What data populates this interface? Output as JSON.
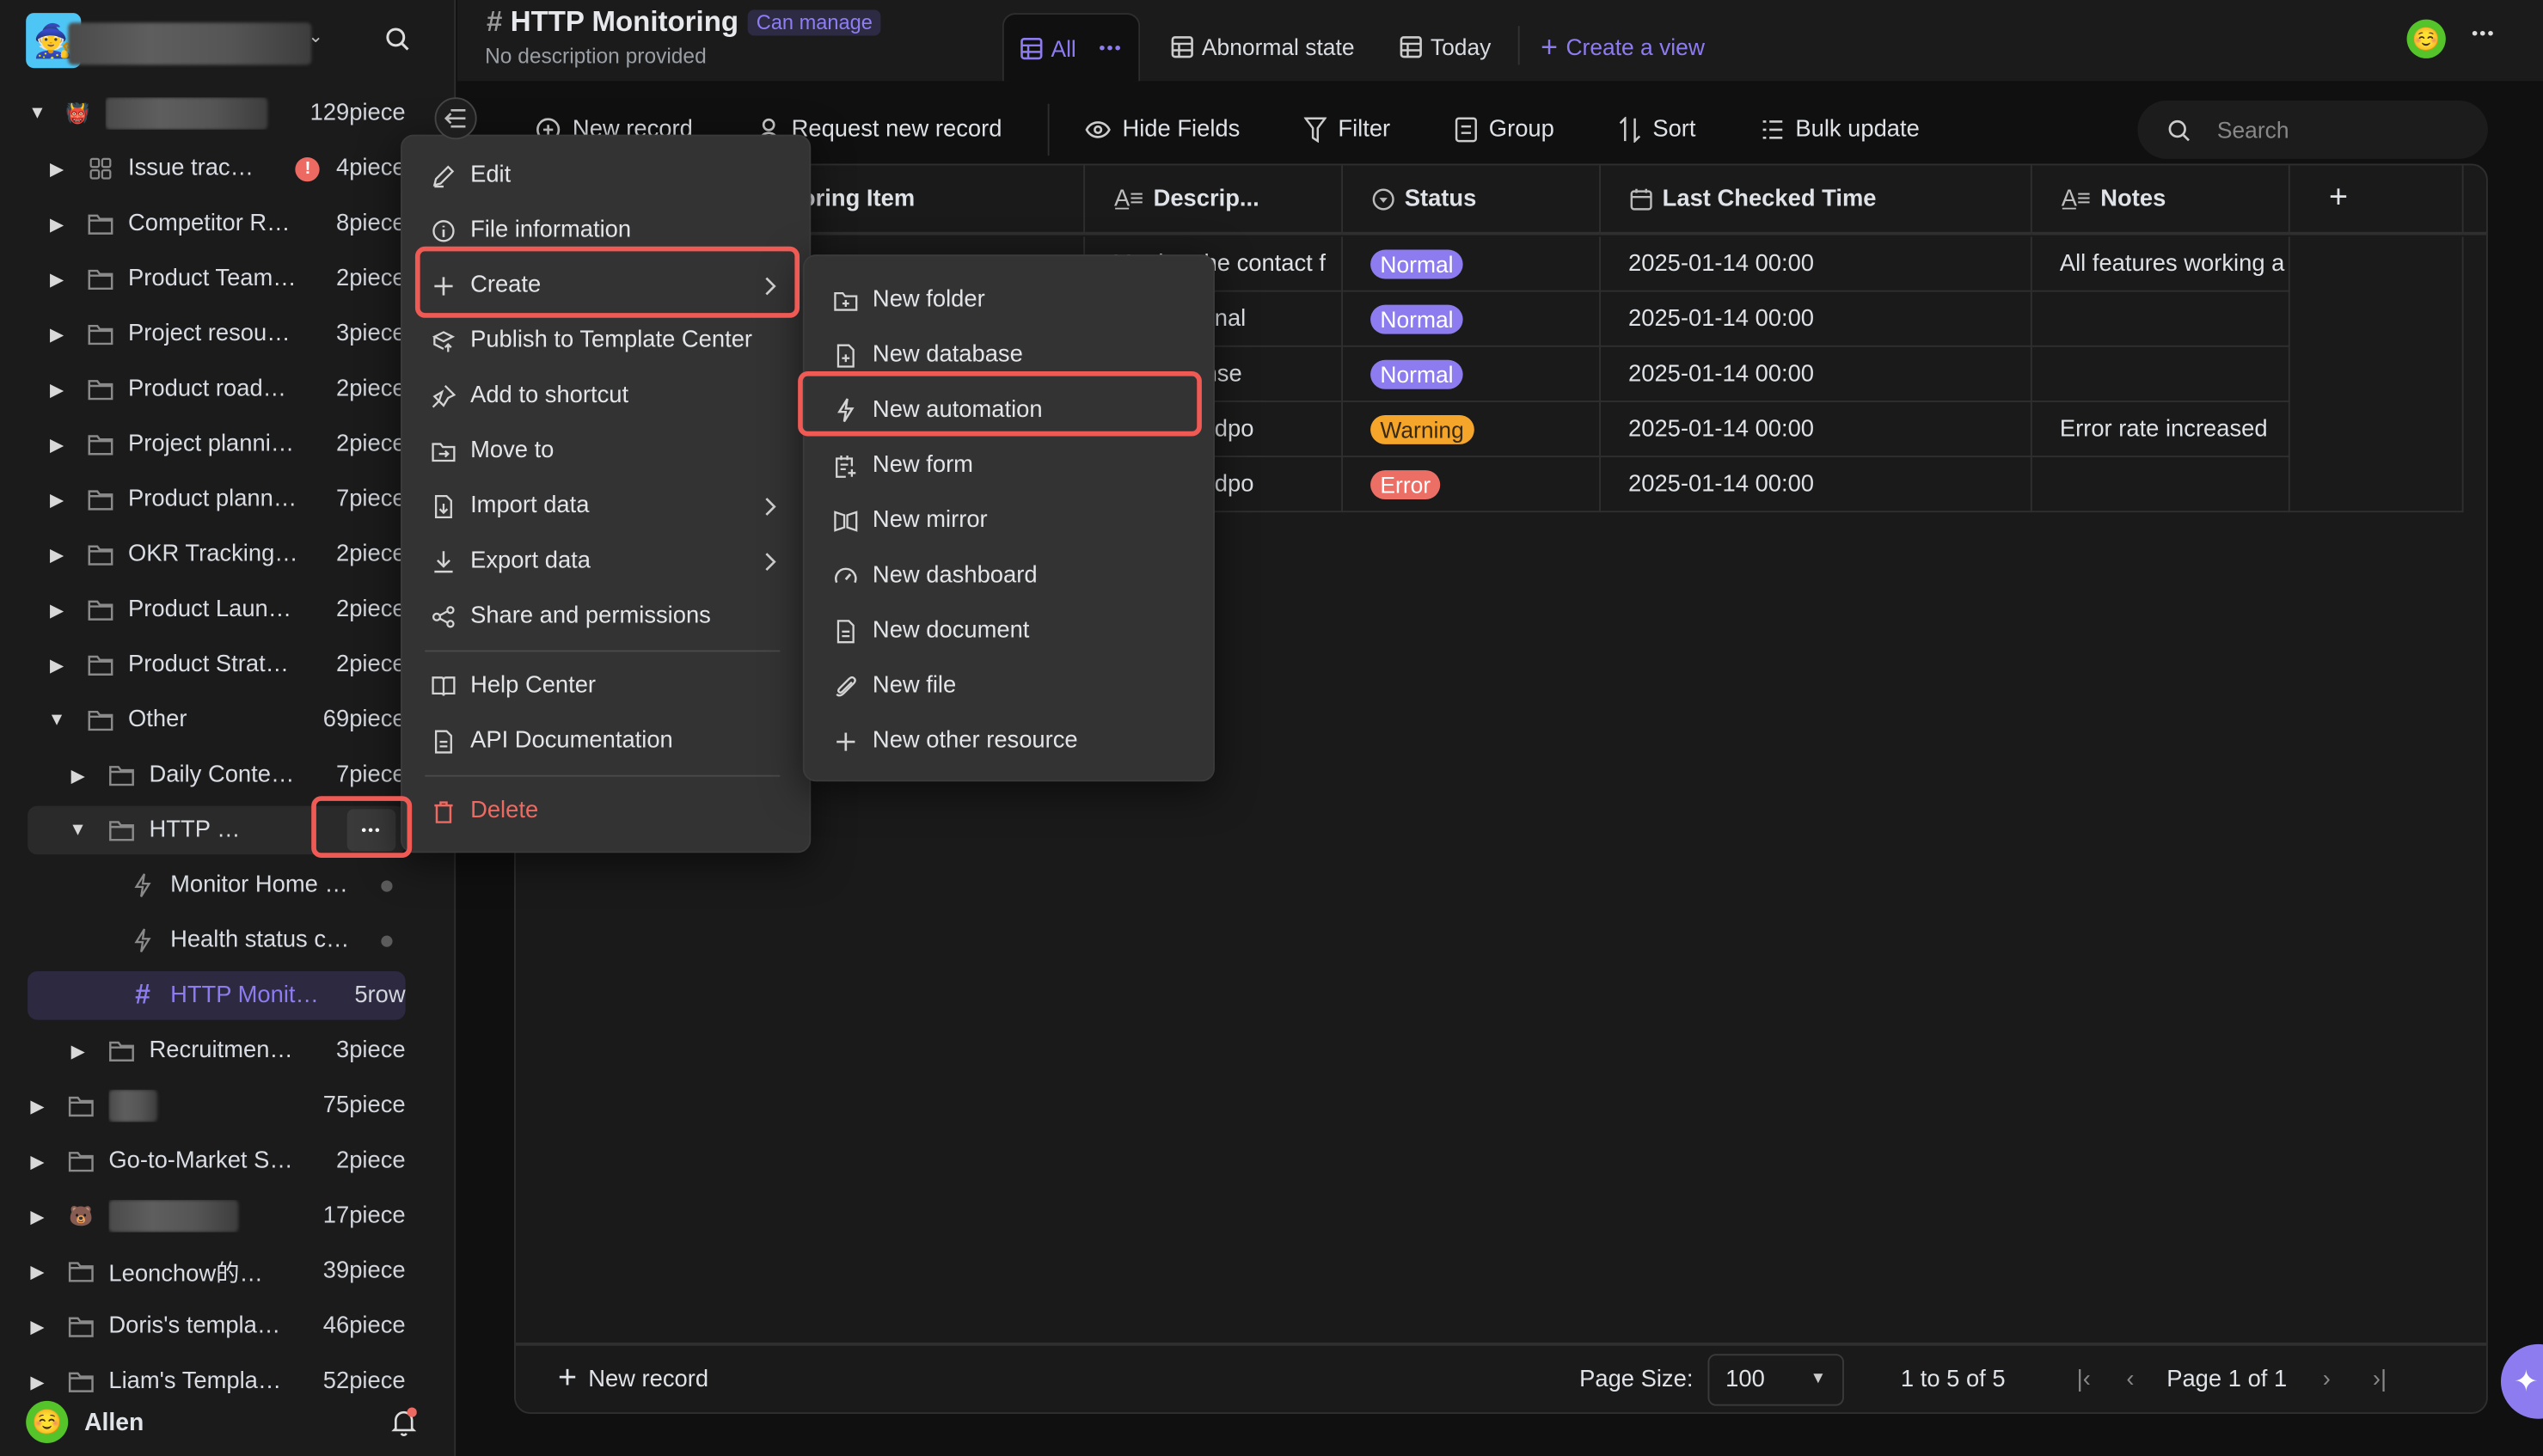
{
  "workspace": {
    "name_redacted": true,
    "avatar_emoji": "🧙"
  },
  "sidebar": {
    "root": {
      "emoji": "👹",
      "count": "129piece"
    },
    "items": [
      {
        "label": "Issue trac…",
        "count": "4piece",
        "icon": "grid-icon",
        "warning": true
      },
      {
        "label": "Competitor R…",
        "count": "8piece",
        "icon": "folder-icon"
      },
      {
        "label": "Product Team…",
        "count": "2piece",
        "icon": "folder-icon"
      },
      {
        "label": "Project resou…",
        "count": "3piece",
        "icon": "folder-icon"
      },
      {
        "label": "Product road…",
        "count": "2piece",
        "icon": "folder-icon"
      },
      {
        "label": "Project planni…",
        "count": "2piece",
        "icon": "folder-icon"
      },
      {
        "label": "Product plann…",
        "count": "7piece",
        "icon": "folder-icon"
      },
      {
        "label": "OKR Tracking…",
        "count": "2piece",
        "icon": "folder-icon"
      },
      {
        "label": "Product Laun…",
        "count": "2piece",
        "icon": "folder-icon"
      },
      {
        "label": "Product Strat…",
        "count": "2piece",
        "icon": "folder-icon"
      },
      {
        "label": "Other",
        "count": "69piece",
        "icon": "folder-icon",
        "expanded": true
      }
    ],
    "other_children": [
      {
        "label": "Daily Conte…",
        "count": "7piece"
      },
      {
        "label": "HTTP …",
        "count": ""
      },
      {
        "label": "Monitor Home …",
        "count": ""
      },
      {
        "label": "Health status c…",
        "count": ""
      },
      {
        "label": "HTTP Monit…",
        "count": "5row"
      },
      {
        "label": "Recruitmen…",
        "count": "3piece"
      }
    ],
    "bottom_items": [
      {
        "label": "",
        "count": "75piece"
      },
      {
        "label": "Go-to-Market S…",
        "count": "2piece"
      },
      {
        "label": "Be…",
        "count": "17piece",
        "emoji": "🐻"
      },
      {
        "label": "Leonchow的…",
        "count": "39piece"
      },
      {
        "label": "Doris's templa…",
        "count": "46piece"
      },
      {
        "label": "Liam's Templa…",
        "count": "52piece"
      }
    ],
    "more_glyph": "•••",
    "user": {
      "name": "Allen",
      "emoji": "☺️"
    }
  },
  "header": {
    "title": "HTTP Monitoring",
    "permission": "Can manage",
    "description": "No description provided",
    "views": [
      {
        "label": "All",
        "active": true
      },
      {
        "label": "Abnormal state"
      },
      {
        "label": "Today"
      }
    ],
    "create_view": "Create a view",
    "more_glyph": "•••"
  },
  "toolbar": {
    "new_record": "New record",
    "request_new_record": "Request new record",
    "hide_fields": "Hide Fields",
    "filter": "Filter",
    "group": "Group",
    "sort": "Sort",
    "bulk_update": "Bulk update",
    "search_placeholder": "Search"
  },
  "table": {
    "columns": [
      "Monitoring Item",
      "Descrip...",
      "Status",
      "Last Checked Time",
      "Notes"
    ],
    "visible_first_col": "oring Item",
    "rows": [
      {
        "description": "Monitor the contact f",
        "status": "Normal",
        "time": "2025-01-14 00:00",
        "notes": "All features working a"
      },
      {
        "description": "he functional",
        "status": "Normal",
        "time": "2025-01-14 00:00",
        "notes": ""
      },
      {
        "description": "he response",
        "status": "Normal",
        "time": "2025-01-14 00:00",
        "notes": ""
      },
      {
        "description": "he API endpo",
        "status": "Warning",
        "time": "2025-01-14 00:00",
        "notes": "Error rate increased"
      },
      {
        "description": "he API endpo",
        "status": "Error",
        "time": "2025-01-14 00:00",
        "notes": ""
      }
    ],
    "status_colors": {
      "Normal": "#8c7cf0",
      "Warning": "#f5a62a",
      "Error": "#ec6f66"
    },
    "status_text_colors": {
      "Normal": "#ffffff",
      "Warning": "#3a2a10",
      "Error": "#ffffff"
    },
    "add_column": "+"
  },
  "footer": {
    "new_record": "New record",
    "page_size_label": "Page Size:",
    "page_size": "100",
    "range": "1 to 5 of 5",
    "page_prefix": "Page",
    "page_current": "1",
    "page_of": "of",
    "page_total": "1"
  },
  "context_menu": {
    "items": [
      {
        "label": "Edit",
        "icon": "pencil-icon"
      },
      {
        "label": "File information",
        "icon": "info-icon"
      },
      {
        "label": "Create",
        "icon": "plus-icon",
        "submenu": true,
        "highlighted": true
      },
      {
        "label": "Publish to Template Center",
        "icon": "publish-icon"
      },
      {
        "label": "Add to shortcut",
        "icon": "pin-icon"
      },
      {
        "label": "Move to",
        "icon": "move-folder-icon"
      },
      {
        "label": "Import data",
        "icon": "import-icon",
        "submenu": true
      },
      {
        "label": "Export data",
        "icon": "export-icon",
        "submenu": true
      },
      {
        "label": "Share and permissions",
        "icon": "share-icon"
      },
      {
        "label": "Help Center",
        "icon": "book-icon"
      },
      {
        "label": "API Documentation",
        "icon": "document-icon"
      },
      {
        "label": "Delete",
        "icon": "trash-icon",
        "danger": true
      }
    ]
  },
  "create_submenu": {
    "items": [
      {
        "label": "New folder",
        "icon": "folder-plus-icon"
      },
      {
        "label": "New database",
        "icon": "database-plus-icon"
      },
      {
        "label": "New automation",
        "icon": "lightning-icon",
        "highlighted": true
      },
      {
        "label": "New form",
        "icon": "form-icon"
      },
      {
        "label": "New mirror",
        "icon": "mirror-icon"
      },
      {
        "label": "New dashboard",
        "icon": "gauge-icon"
      },
      {
        "label": "New document",
        "icon": "document-icon"
      },
      {
        "label": "New file",
        "icon": "paperclip-icon"
      },
      {
        "label": "New other resource",
        "icon": "plus-icon"
      }
    ]
  },
  "colors": {
    "accent": "#8c7cf0",
    "highlight": "#ef5a55",
    "danger": "#ec6a62"
  }
}
